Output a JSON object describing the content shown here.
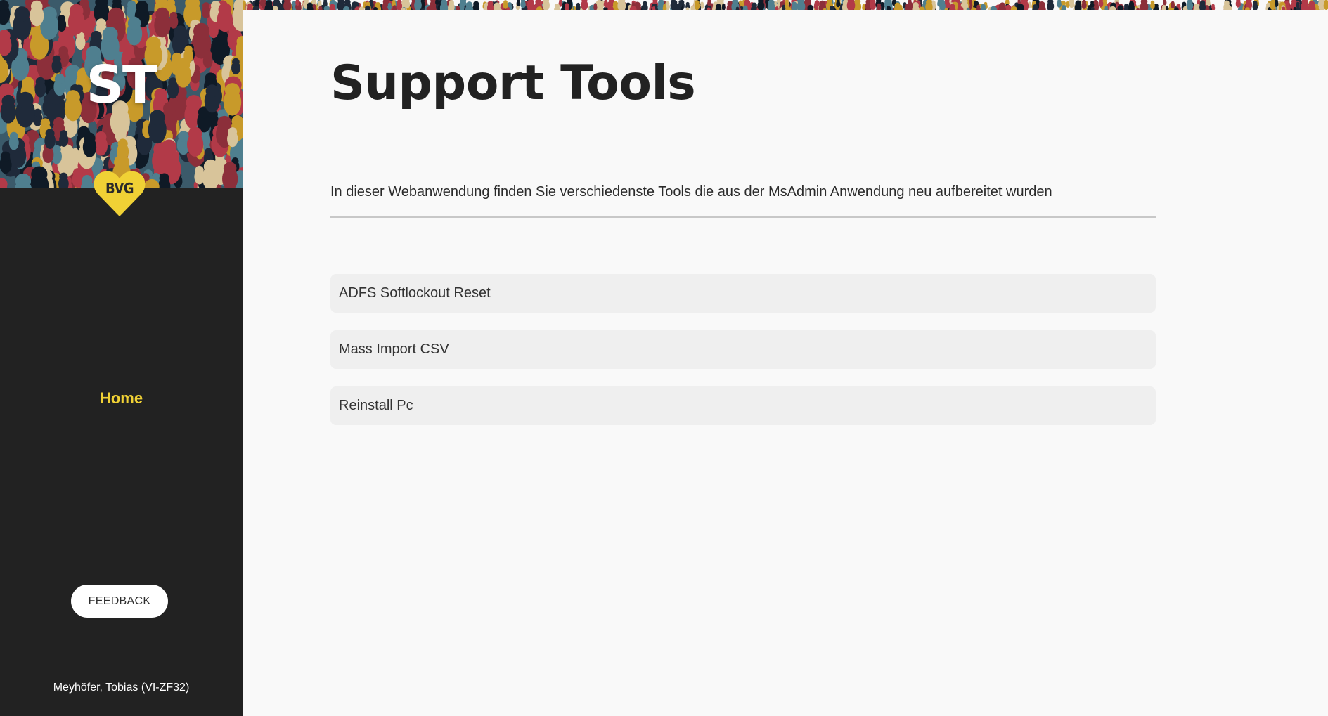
{
  "sidebar": {
    "logo_text": "ST",
    "brand_badge": "BVG",
    "nav": [
      {
        "label": "Home",
        "active": true
      }
    ],
    "feedback_label": "FEEDBACK",
    "user": "Meyhöfer, Tobias (VI-ZF32)"
  },
  "main": {
    "title": "Support Tools",
    "intro": "In dieser Webanwendung finden Sie verschiedenste Tools die aus der MsAdmin Anwendung neu aufbereitet wurden",
    "tools": [
      {
        "label": "ADFS Softlockout Reset"
      },
      {
        "label": "Mass Import CSV"
      },
      {
        "label": "Reinstall Pc"
      }
    ]
  },
  "colors": {
    "sidebar_bg": "#222222",
    "accent_yellow": "#f0d135",
    "main_bg": "#f9f9f9",
    "tool_bg": "#efefef",
    "title_text": "#222222"
  },
  "icons": [
    "bvg-heart-logo",
    "crowd-pattern-banner"
  ]
}
